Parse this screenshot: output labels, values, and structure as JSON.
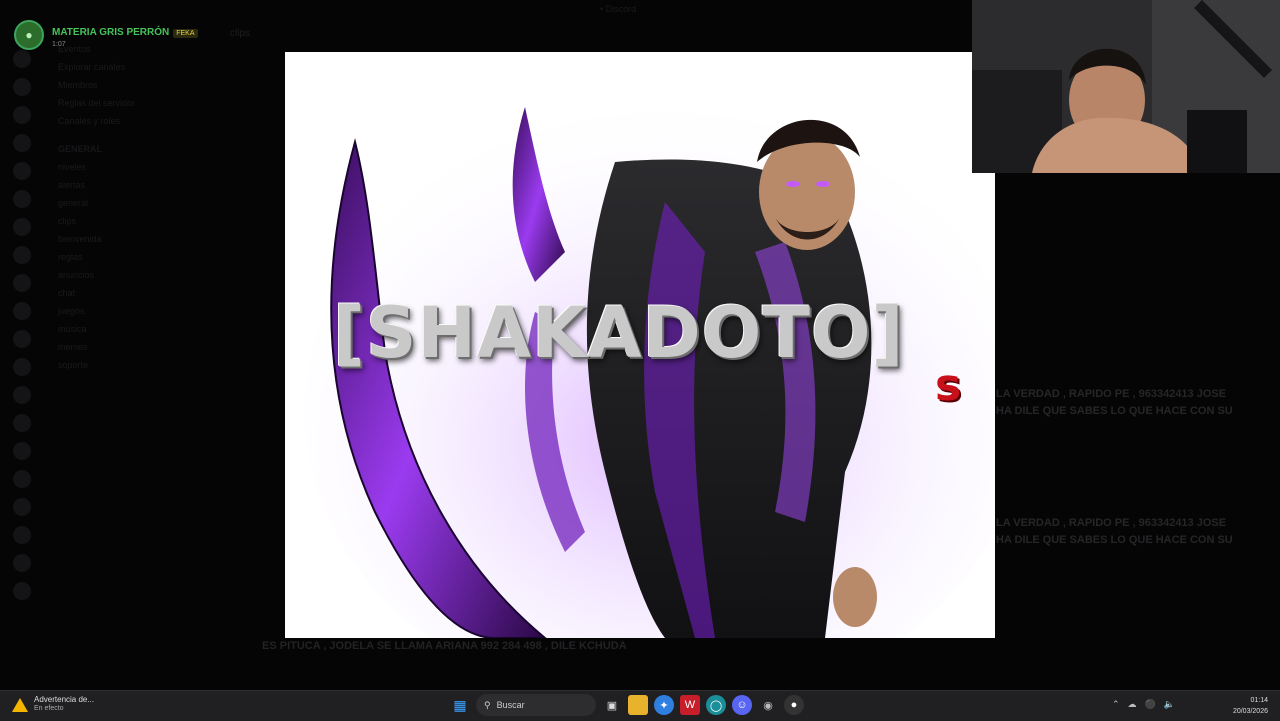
{
  "window": {
    "title": "• Discord"
  },
  "voice_overlay": {
    "name": "MATERIA GRIS PERRÓN",
    "badge": "FEKA",
    "time": "1:07"
  },
  "discord_bg": {
    "channel_header": "clips",
    "channels": [
      "Eventos",
      "Explorar canales",
      "Miembros",
      "Reglas del servidor",
      "Canales y roles",
      "GENERAL",
      "niveles",
      "alertas",
      "general",
      "clips",
      "bienvenida",
      "reglas",
      "anuncios",
      "chat",
      "juegos",
      "música",
      "memes",
      "soporte"
    ],
    "lines": [
      "LA VERDAD , RAPIDO PE , 963342413 JOSE",
      "HA DILE QUE SABES LO QUE HACE CON SU",
      "ES PITUCA , JODELA SE LLAMA ARIANA 992 284 498 , DILE KCHUDA"
    ]
  },
  "poster": {
    "title": "[SHAKADOTO]",
    "suffix": "s"
  },
  "taskbar": {
    "notification_title": "Advertencia de...",
    "notification_subtitle": "En efecto",
    "search_placeholder": "Buscar",
    "time": "01:14",
    "date": "20/03/2026"
  }
}
